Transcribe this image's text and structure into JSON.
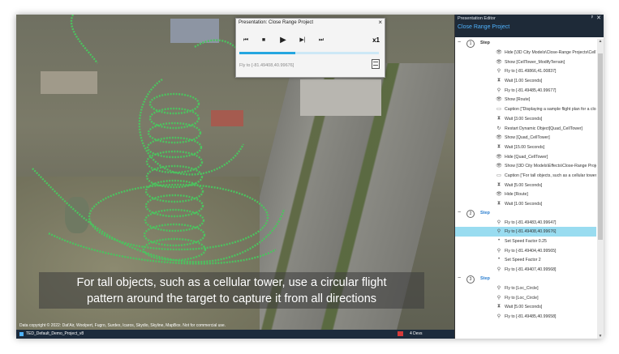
{
  "player": {
    "title": "Presentation: Close Range Project",
    "close": "×",
    "speed": "x1",
    "progress": 0.4,
    "status": "Fly to [-81.49408,40.99676]",
    "buttons": [
      {
        "name": "previous-step-button",
        "glyph": "⏮"
      },
      {
        "name": "stop-button",
        "glyph": "■"
      },
      {
        "name": "play-button",
        "glyph": "▶"
      },
      {
        "name": "step-forward-button",
        "glyph": "▶|"
      },
      {
        "name": "next-step-button",
        "glyph": "⏭"
      }
    ]
  },
  "caption": {
    "line1": "For tall objects, such as a cellular tower, use a circular flight",
    "line2": "pattern around the target to capture it from all directions"
  },
  "statusbar": {
    "copyright": "Data copyright © 2022: Dat'Air, Woolpert, Fugro, Surdex, Icaros, Skydio, Skyline, MapBox. Not for commercial use.",
    "project": "TED_Default_Demo_Project_v8",
    "info": "4 Devs"
  },
  "panel": {
    "title": "Presentation Editor",
    "project": "Close Range Project",
    "pin": "ᵖ",
    "close": "✕",
    "groups": [
      {
        "num": "1",
        "label": "Step",
        "items": [
          {
            "icon": "eye",
            "text": "Hide [\\3D City Models\\Close-Range Projects\\CellTower]"
          },
          {
            "icon": "eye",
            "text": "Show [CellTower_ModifyTerrain]"
          },
          {
            "icon": "pin",
            "text": "Fly to [-81.49866,41.00837]"
          },
          {
            "icon": "hourglass",
            "text": "Wait [1.00 Seconds]"
          },
          {
            "icon": "pin",
            "text": "Fly to [-81.49485,40.99677]"
          },
          {
            "icon": "eye",
            "text": "Show [Route]"
          },
          {
            "icon": "caption",
            "text": "Caption [\"Displaying a sample flight plan for a close-range project\"]"
          },
          {
            "icon": "hourglass",
            "text": "Wait [3.00 Seconds]"
          },
          {
            "icon": "restart",
            "text": "Restart Dynamic Object[Quad_CellTower]"
          },
          {
            "icon": "eye",
            "text": "Show [Quad_CellTower]"
          },
          {
            "icon": "hourglass",
            "text": "Wait [15.00 Seconds]"
          },
          {
            "icon": "eye",
            "text": "Hide [Quad_CellTower]"
          },
          {
            "icon": "eye",
            "text": "Show [\\3D City Models\\Effects\\Close-Range Projects\\CellTower]"
          },
          {
            "icon": "caption",
            "text": "Caption [\"For tall objects, such as a cellular tower, use a circular flight\"]"
          },
          {
            "icon": "hourglass",
            "text": "Wait [5.00 Seconds]"
          },
          {
            "icon": "eye",
            "text": "Hide [Route]"
          },
          {
            "icon": "hourglass",
            "text": "Wait [1.00 Seconds]"
          }
        ]
      },
      {
        "num": "2",
        "label": "Step",
        "items": [
          {
            "icon": "pin",
            "text": "Fly to [-81.49483,40.99647]"
          },
          {
            "icon": "pin",
            "text": "Fly to [-81.49408,40.99676]",
            "selected": true
          },
          {
            "icon": "dot",
            "text": "Set Speed Factor 0.25"
          },
          {
            "icon": "pin",
            "text": "Fly to [-81.49404,40.99565]"
          },
          {
            "icon": "dot",
            "text": "Set Speed Factor 2"
          },
          {
            "icon": "pin",
            "text": "Fly to [-81.49407,40.99568]"
          }
        ]
      },
      {
        "num": "3",
        "label": "Step",
        "items": [
          {
            "icon": "pin",
            "text": "Fly to [Loc_Circle]"
          },
          {
            "icon": "pin",
            "text": "Fly to [Loc_Circle]"
          },
          {
            "icon": "hourglass",
            "text": "Wait [5.00 Seconds]"
          },
          {
            "icon": "pin",
            "text": "Fly to [-81.49485,40.99658]"
          }
        ]
      }
    ]
  },
  "colors": {
    "accent": "#2c7fd0",
    "selection": "#99dcf0",
    "progress": "#25a6e0",
    "ribbon": "#4cc35f"
  }
}
